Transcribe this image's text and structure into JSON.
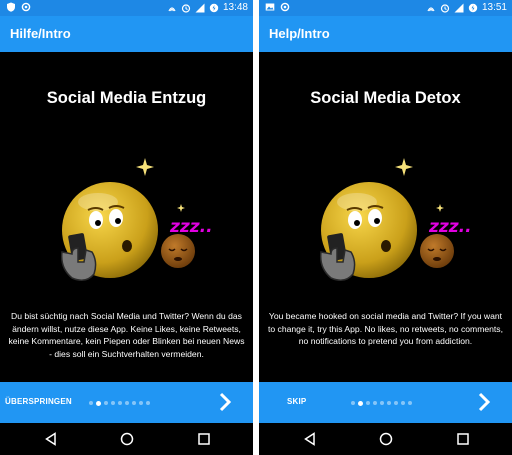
{
  "colors": {
    "statusbar": "#1e88e5",
    "appbar": "#2196f3",
    "background": "#000000",
    "emoji_yellow": "#e2b325",
    "moon": "#f6e17a",
    "zzz": "#e100e1"
  },
  "screens": [
    {
      "status": {
        "time": "13:48",
        "icons": [
          "shield-icon",
          "circle-icon",
          "nfc-icon",
          "alarm-icon",
          "signal-icon",
          "battery-icon"
        ]
      },
      "appbar": {
        "title": "Hilfe/Intro"
      },
      "slide": {
        "title": "Social Media Entzug",
        "text": "Du bist süchtig nach Social Media und Twitter? Wenn du das ändern willst, nutze diese App. Keine Likes, keine Retweets, keine Kommentare, kein Piepen oder Blinken bei neuen News - dies soll ein Suchtverhalten vermeiden.",
        "zzz": "zzz.."
      },
      "footer": {
        "skip_label": "ÜBERSPRINGEN",
        "page_count": 9,
        "active_page": 2
      }
    },
    {
      "status": {
        "time": "13:51",
        "icons": [
          "image-icon",
          "circle-icon",
          "nfc-icon",
          "alarm-icon",
          "signal-icon",
          "battery-icon"
        ]
      },
      "appbar": {
        "title": "Help/Intro"
      },
      "slide": {
        "title": "Social Media Detox",
        "text": "You became hooked on social media and Twitter? If you want to change it, try this App. No likes, no retweets, no comments, no notifications to pretend you from addiction.",
        "zzz": "zzz.."
      },
      "footer": {
        "skip_label": "SKIP",
        "page_count": 9,
        "active_page": 2
      }
    }
  ],
  "navbar": {
    "buttons": [
      "back-icon",
      "home-icon",
      "recents-icon"
    ]
  }
}
